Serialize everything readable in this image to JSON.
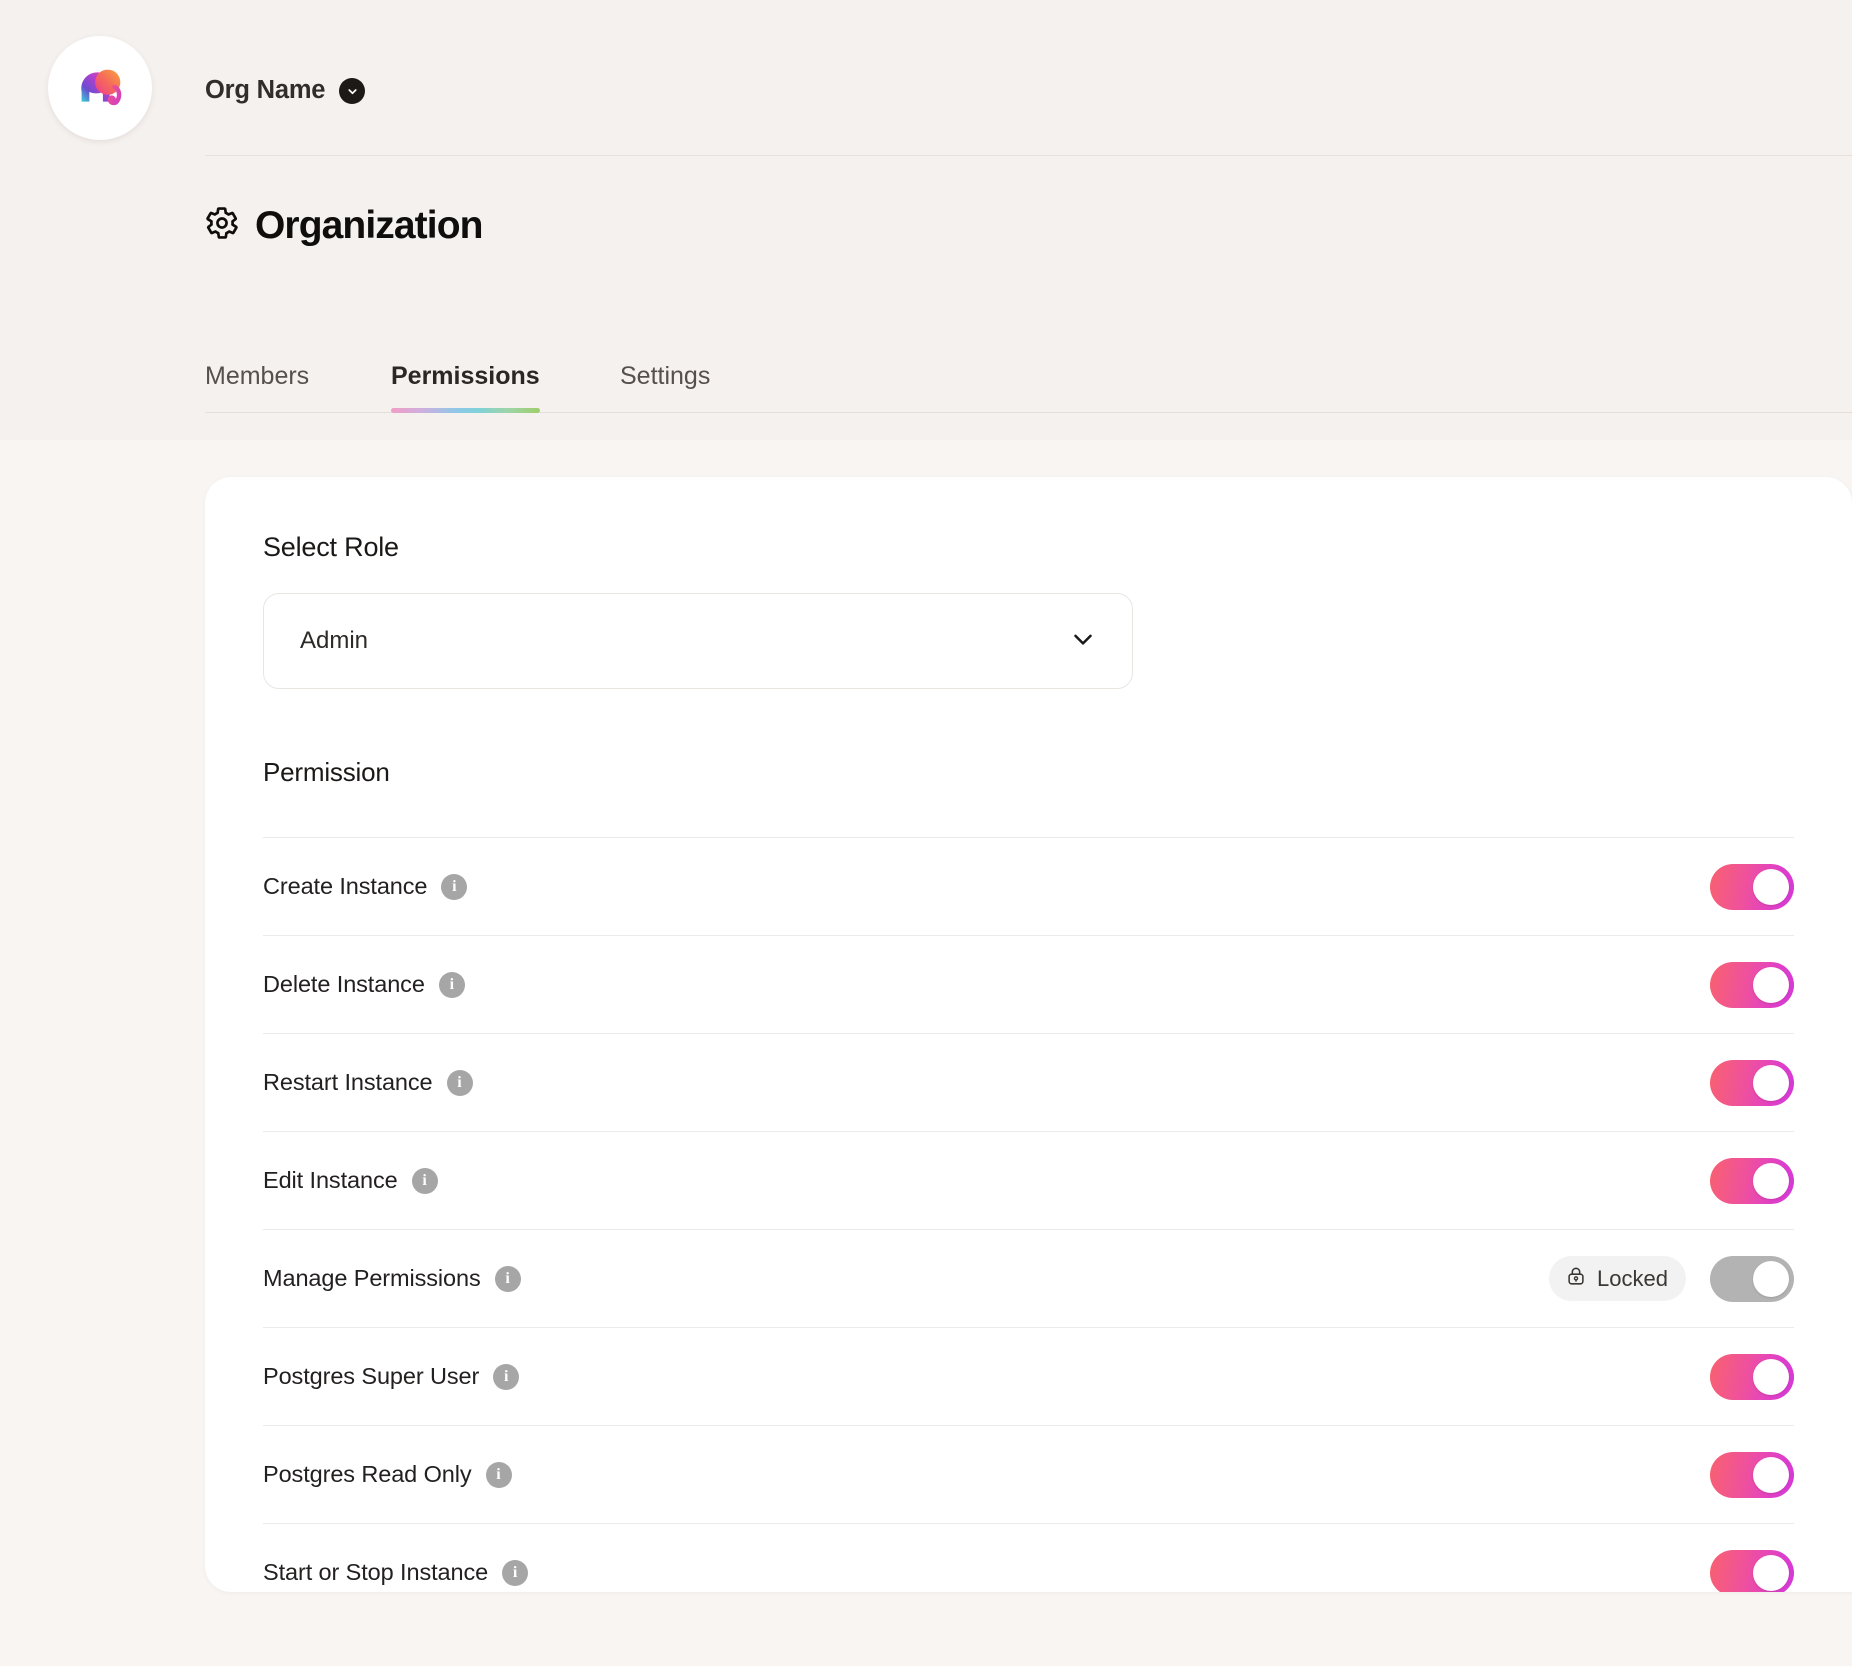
{
  "org": {
    "name": "Org Name",
    "logo_icon": "elephant-logo",
    "chevron_icon": "chevron-down-icon"
  },
  "page": {
    "title": "Organization",
    "title_icon": "gear-icon"
  },
  "tabs": [
    {
      "label": "Members",
      "active": false
    },
    {
      "label": "Permissions",
      "active": true
    },
    {
      "label": "Settings",
      "active": false
    }
  ],
  "role_select": {
    "label": "Select Role",
    "value": "Admin",
    "chevron_icon": "chevron-down-icon"
  },
  "permissions_section": {
    "heading": "Permission",
    "locked_label": "Locked",
    "lock_icon": "lock-icon",
    "info_icon": "info-icon",
    "info_glyph": "i",
    "rows": [
      {
        "name": "Create Instance",
        "enabled": true,
        "locked": false
      },
      {
        "name": "Delete Instance",
        "enabled": true,
        "locked": false
      },
      {
        "name": "Restart Instance",
        "enabled": true,
        "locked": false
      },
      {
        "name": "Edit Instance",
        "enabled": true,
        "locked": false
      },
      {
        "name": "Manage Permissions",
        "enabled": true,
        "locked": true
      },
      {
        "name": "Postgres Super User",
        "enabled": true,
        "locked": false
      },
      {
        "name": "Postgres Read Only",
        "enabled": true,
        "locked": false
      },
      {
        "name": "Start or Stop Instance",
        "enabled": true,
        "locked": false
      }
    ]
  },
  "colors": {
    "page_background": "#f5f1ee",
    "card_background": "#ffffff",
    "toggle_on_start": "#f8616f",
    "toggle_on_end": "#d338d8",
    "toggle_locked": "#b3b3b3",
    "accent_gradient_start": "#f19ec6",
    "accent_gradient_end": "#9fcd6a",
    "text_primary": "#1b1917",
    "text_muted": "#55504c"
  }
}
